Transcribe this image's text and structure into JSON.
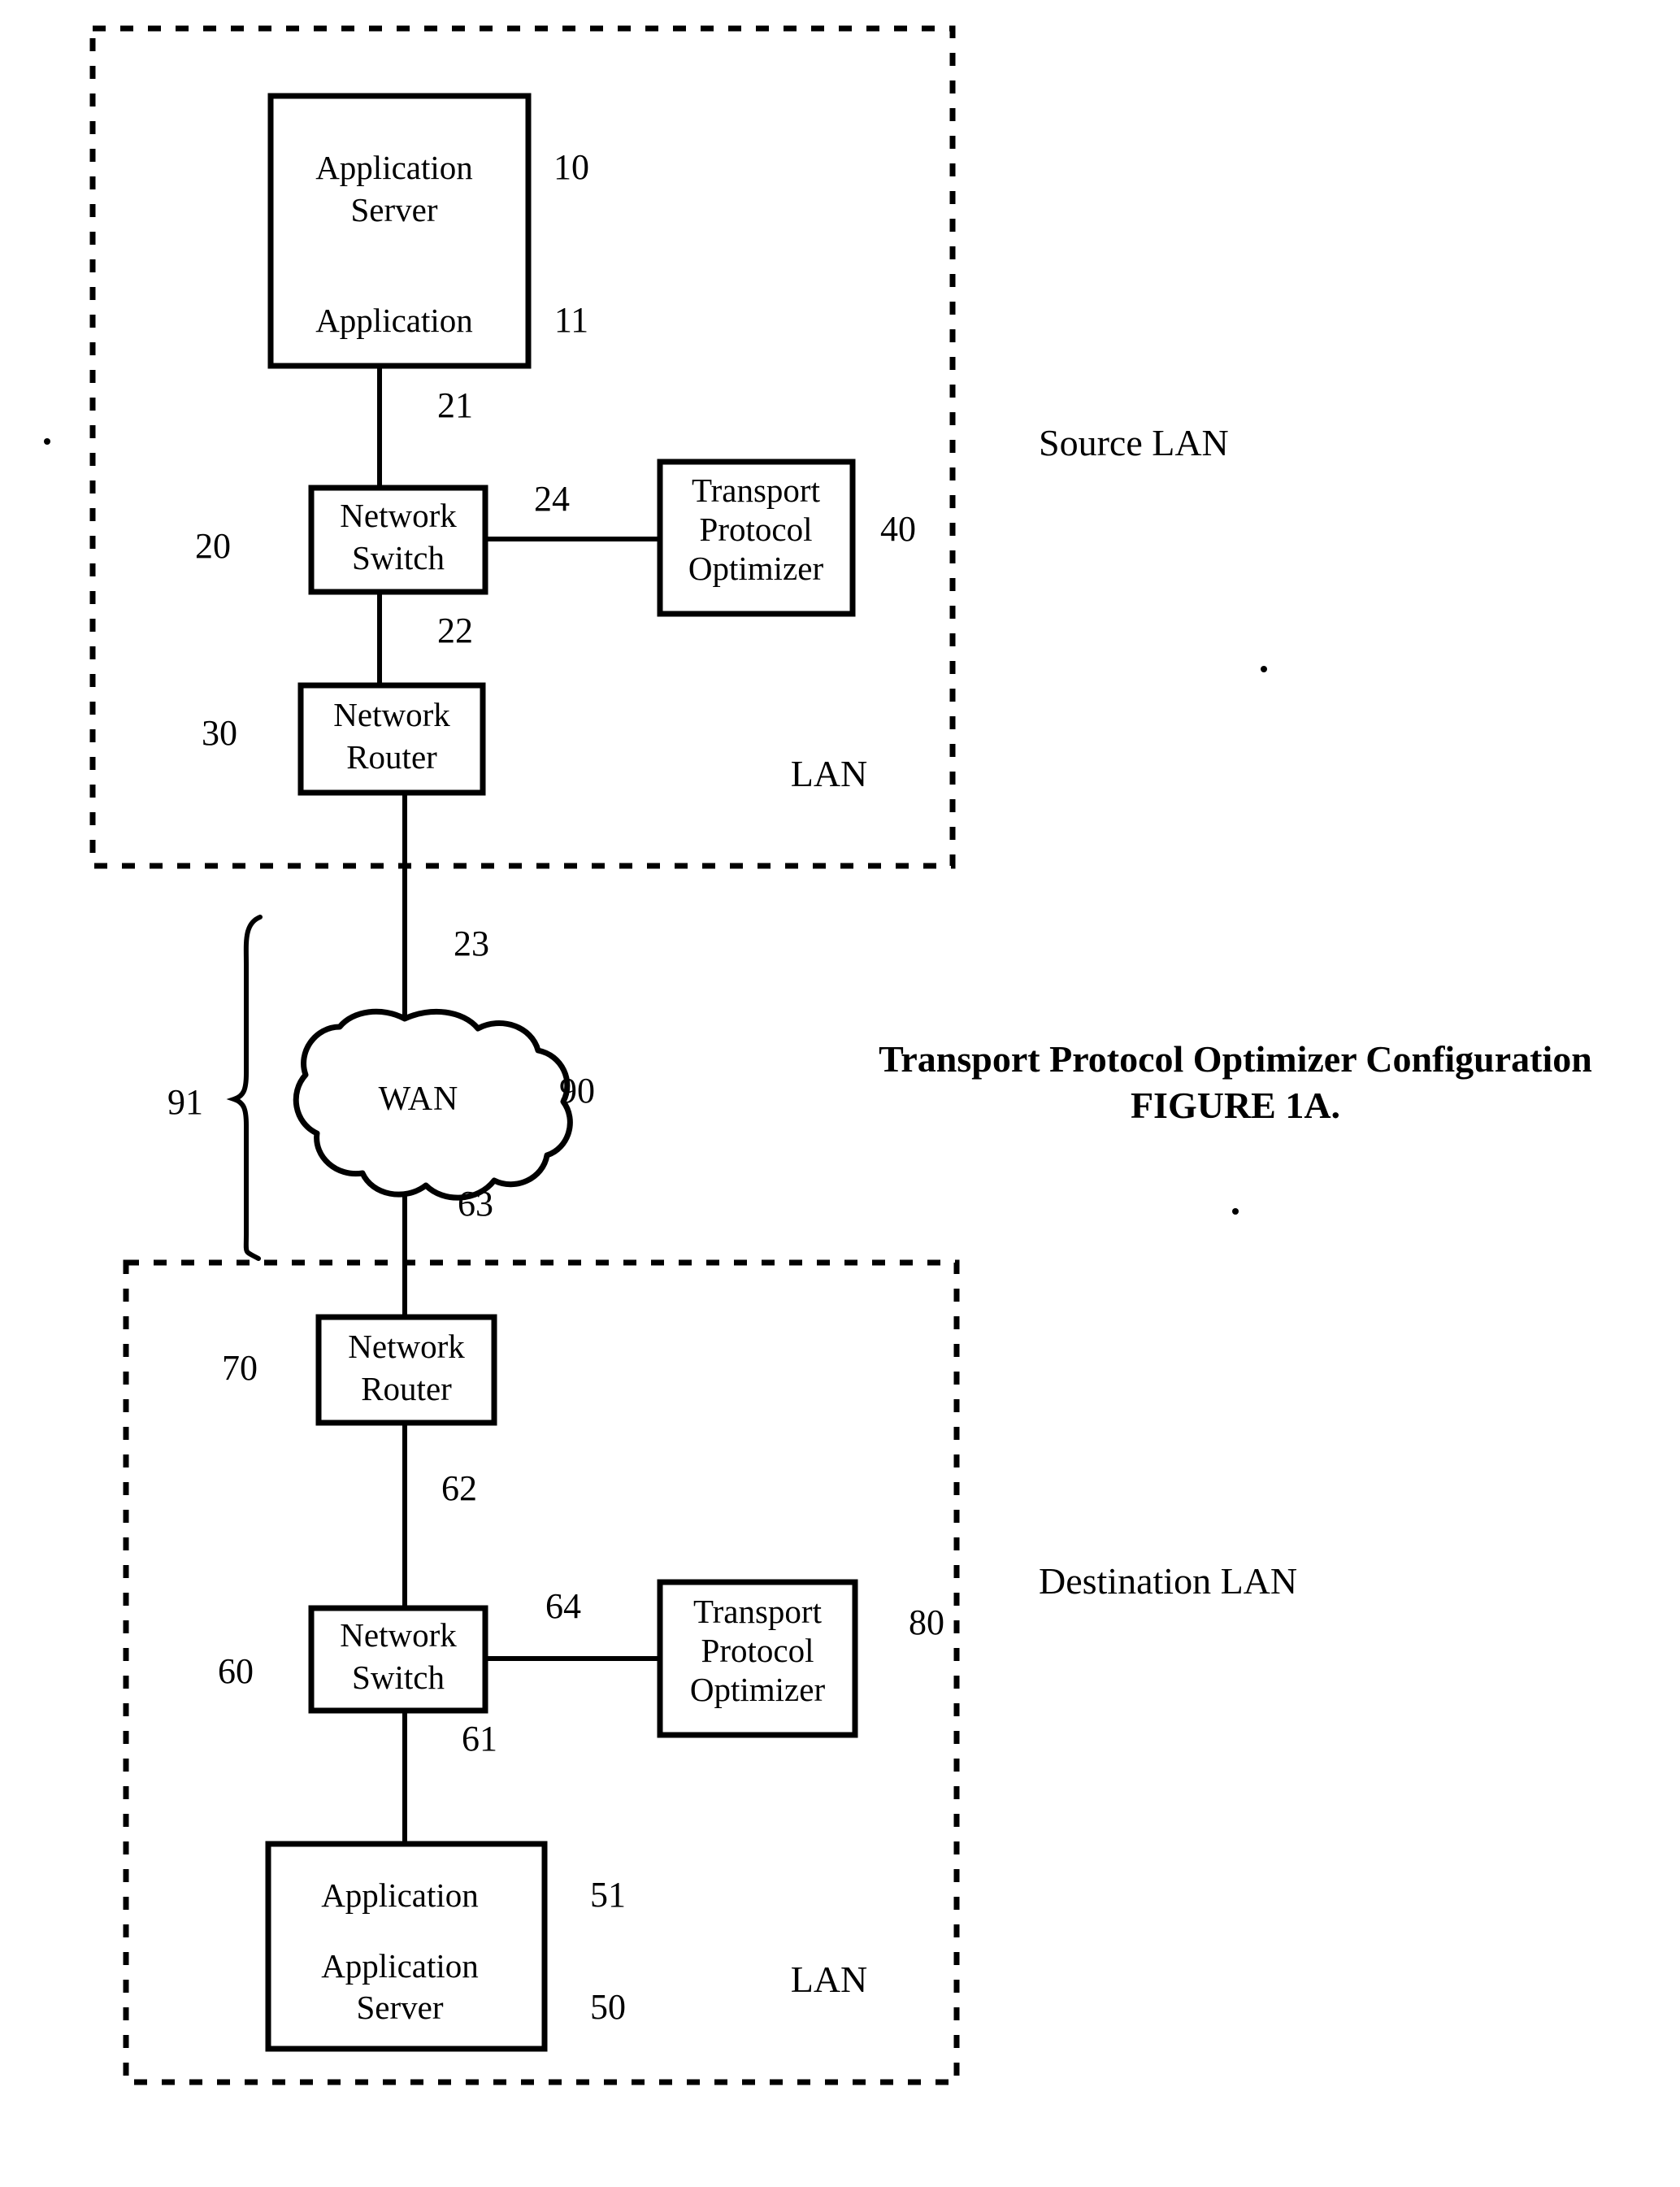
{
  "figure": {
    "title_line1": "Transport Protocol Optimizer Configuration",
    "title_line2": "FIGURE 1A."
  },
  "zones": {
    "source": {
      "label": "Source LAN",
      "inner_label": "LAN"
    },
    "destination": {
      "label": "Destination LAN",
      "inner_label": "LAN"
    }
  },
  "nodes": {
    "source_app_server": {
      "line1": "Application",
      "line2": "Server",
      "line3": "Application",
      "ref_server": "10",
      "ref_application": "11"
    },
    "source_switch": {
      "line1": "Network",
      "line2": "Switch",
      "ref": "20"
    },
    "source_optimizer": {
      "line1": "Transport",
      "line2": "Protocol",
      "line3": "Optimizer",
      "ref": "40"
    },
    "source_router": {
      "line1": "Network",
      "line2": "Router",
      "ref": "30"
    },
    "wan": {
      "label": "WAN",
      "ref": "90",
      "brace_ref": "91"
    },
    "dest_router": {
      "line1": "Network",
      "line2": "Router",
      "ref": "70"
    },
    "dest_switch": {
      "line1": "Network",
      "line2": "Switch",
      "ref": "60"
    },
    "dest_optimizer": {
      "line1": "Transport",
      "line2": "Protocol",
      "line3": "Optimizer",
      "ref": "80"
    },
    "dest_app_server": {
      "line1": "Application",
      "line2": "Application",
      "line3": "Server",
      "ref_application": "51",
      "ref_server": "50"
    }
  },
  "links": {
    "app_to_switch": "21",
    "switch_to_router": "22",
    "switch_to_optimizer": "24",
    "router_to_wan": "23",
    "wan_to_dest_router": "63",
    "dest_router_to_switch": "62",
    "dest_switch_to_optimizer": "64",
    "dest_switch_to_app": "61"
  },
  "colors": {
    "ink": "#000000",
    "paper": "#ffffff"
  }
}
